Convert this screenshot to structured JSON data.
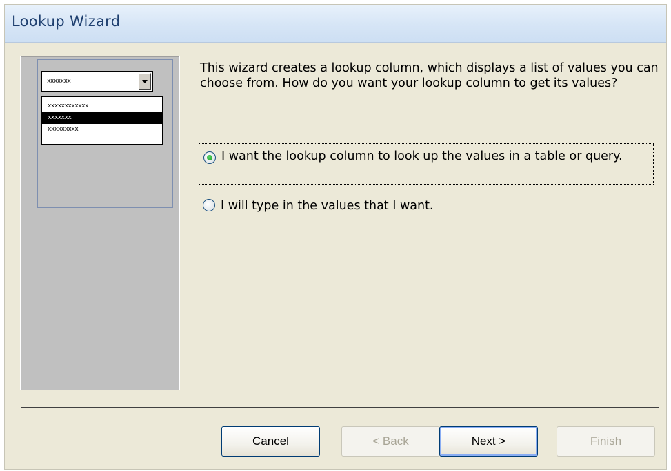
{
  "window": {
    "title": "Lookup Wizard"
  },
  "illustration": {
    "combo_value": "xxxxxxx",
    "list_items": [
      "xxxxxxxxxxxx",
      "xxxxxxx",
      "xxxxxxxxx"
    ],
    "selected_index": 1
  },
  "instructions": "This wizard creates a lookup column, which displays a list of values you can choose from.  How do you want your lookup column to get its values?",
  "options": [
    {
      "label": "I want the lookup column to look up the values in a table or query.",
      "checked": true
    },
    {
      "label": "I will type in the values that I want.",
      "checked": false
    }
  ],
  "buttons": {
    "cancel": "Cancel",
    "back": "< Back",
    "next": "Next >",
    "finish": "Finish"
  },
  "colors": {
    "dialog_bg": "#ece9d8",
    "title_text": "#1e3f6f",
    "radio_dot": "#21a121"
  }
}
